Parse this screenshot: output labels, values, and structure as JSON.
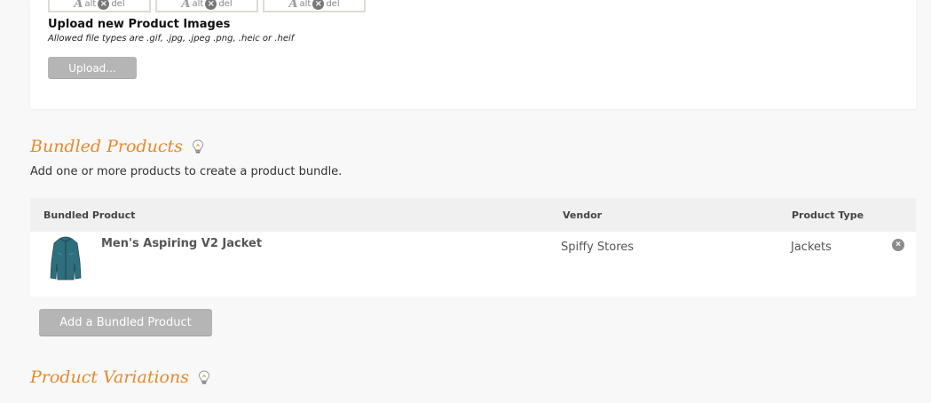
{
  "images_panel": {
    "thumbnails": [
      {
        "alt_label": "alt",
        "del_label": "del"
      },
      {
        "alt_label": "alt",
        "del_label": "del"
      },
      {
        "alt_label": "alt",
        "del_label": "del"
      }
    ],
    "alt_glyph": "A",
    "del_glyph": "×",
    "upload_title": "Upload new Product Images",
    "upload_hint": "Allowed file types are .gif, .jpg, .jpeg .png, .heic or .heif",
    "upload_button_label": "Upload..."
  },
  "bundled_products": {
    "title": "Bundled Products",
    "description": "Add one or more products to create a product bundle.",
    "columns": {
      "product": "Bundled Product",
      "vendor": "Vendor",
      "type": "Product Type"
    },
    "rows": [
      {
        "name": "Men's Aspiring V2 Jacket",
        "vendor": "Spiffy Stores",
        "type": "Jackets",
        "remove_glyph": "×"
      }
    ],
    "add_button_label": "Add a Bundled Product"
  },
  "product_variations": {
    "title": "Product Variations"
  },
  "colors": {
    "section_title": "#e8892b",
    "button_bg": "#b5b5b5",
    "panel_bg": "#ffffff",
    "page_bg": "#f8f8f8"
  },
  "icons": {
    "help": "lightbulb-icon",
    "remove": "remove-circle-icon",
    "delete": "delete-circle-icon",
    "alt_text": "alt-text-icon"
  }
}
